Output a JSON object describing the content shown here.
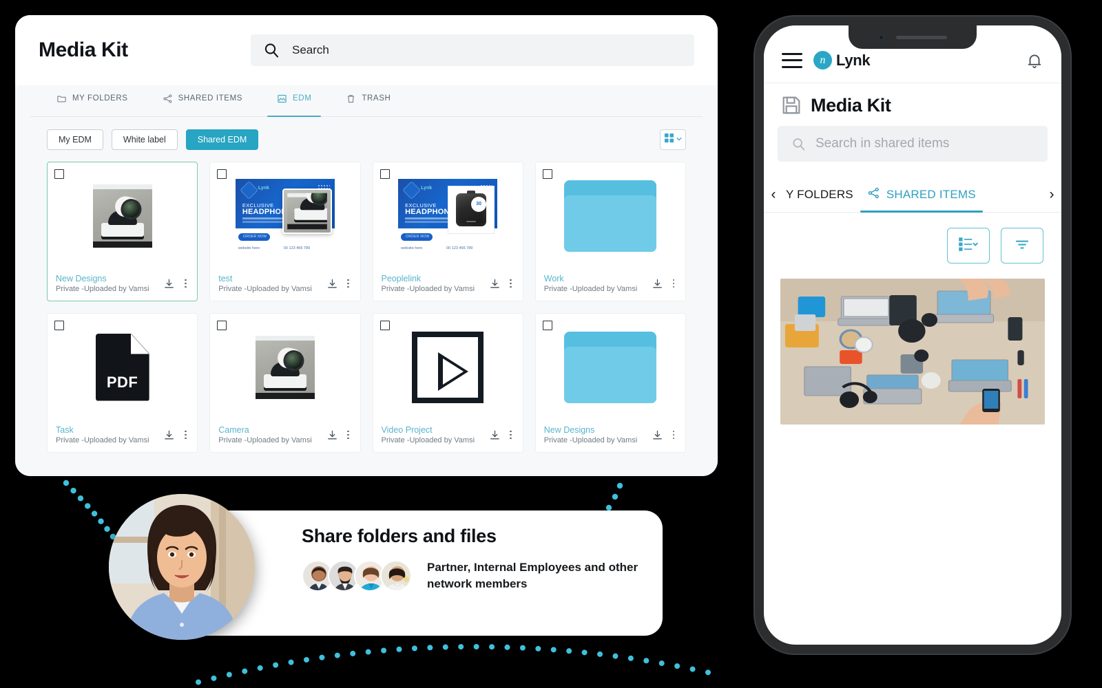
{
  "desktop": {
    "title": "Media Kit",
    "search": {
      "placeholder": "Search",
      "value": "Search",
      "icon": "search-icon"
    },
    "tabs": [
      {
        "label": "MY FOLDERS",
        "icon": "folder-icon",
        "active": false
      },
      {
        "label": "SHARED ITEMS",
        "icon": "share-icon",
        "active": false
      },
      {
        "label": "EDM",
        "icon": "image-icon",
        "active": true
      },
      {
        "label": "TRASH",
        "icon": "trash-icon",
        "active": false
      }
    ],
    "filters": [
      {
        "label": "My EDM",
        "active": false
      },
      {
        "label": "White label",
        "active": false
      },
      {
        "label": "Shared EDM",
        "active": true
      }
    ],
    "view_toggle": {
      "icon": "grid-view-icon",
      "chevron": "chevron-down-icon"
    },
    "cards": [
      {
        "name": "New Designs",
        "meta": "Private -Uploaded by Vamsi",
        "thumb": "camera-photo",
        "selected": true
      },
      {
        "name": "test",
        "meta": "Private -Uploaded by Vamsi",
        "thumb": "edm-banner-camera",
        "selected": false
      },
      {
        "name": "Peoplelink",
        "meta": "Private -Uploaded by Vamsi",
        "thumb": "edm-banner-speaker",
        "selected": false
      },
      {
        "name": "Work",
        "meta": "Private -Uploaded by Vamsi",
        "thumb": "folder",
        "selected": false
      },
      {
        "name": "Task",
        "meta": "Private -Uploaded by Vamsi",
        "thumb": "pdf",
        "selected": false
      },
      {
        "name": "Camera",
        "meta": "Private -Uploaded by Vamsi",
        "thumb": "camera-photo",
        "selected": false
      },
      {
        "name": "Video Project",
        "meta": "Private -Uploaded by Vamsi",
        "thumb": "video",
        "selected": false
      },
      {
        "name": "New Designs",
        "meta": "Private -Uploaded by Vamsi",
        "thumb": "folder",
        "selected": false
      }
    ],
    "card_actions": {
      "download": "download-icon",
      "more": "more-options-icon"
    },
    "edm_art": {
      "brand": "Lynk",
      "line1": "EXCLUSIVE",
      "line2": "HEADPHONE",
      "cta": "ORDER NOW",
      "website": "website here",
      "phone": "00 123 456 789",
      "badge": "30"
    }
  },
  "phone": {
    "menu_icon": "hamburger-menu-icon",
    "brand": {
      "mark": "n",
      "name": "Lynk"
    },
    "bell_icon": "notification-bell-icon",
    "page_title": "Media Kit",
    "page_title_icon": "save-disk-icon",
    "search": {
      "placeholder": "Search in shared items",
      "icon": "search-icon"
    },
    "tabs": [
      {
        "label": "Y FOLDERS",
        "icon": "none",
        "active": false
      },
      {
        "label": "SHARED ITEMS",
        "icon": "share-icon",
        "active": true
      }
    ],
    "nav_prev": "‹",
    "nav_next": "›",
    "toolbar": [
      {
        "name": "list-view-button",
        "icon": "list-view-icon"
      },
      {
        "name": "filter-button",
        "icon": "filter-icon"
      }
    ],
    "photo_alt": "workspace-desk-laptops-photo"
  },
  "share_card": {
    "title": "Share folders and files",
    "subtitle": "Partner,  Internal Employees and other network members",
    "avatar_count": 4
  },
  "colors": {
    "accent_teal": "#2aa7c6",
    "tab_active": "#4aacc4",
    "card_link": "#59b4cc",
    "folder_light": "#6fcbe8",
    "folder_dark": "#56bfe0",
    "dot_teal": "#3fc0dc",
    "background": "#000000",
    "panel": "#ffffff",
    "panel_body": "#f7f8fa"
  }
}
